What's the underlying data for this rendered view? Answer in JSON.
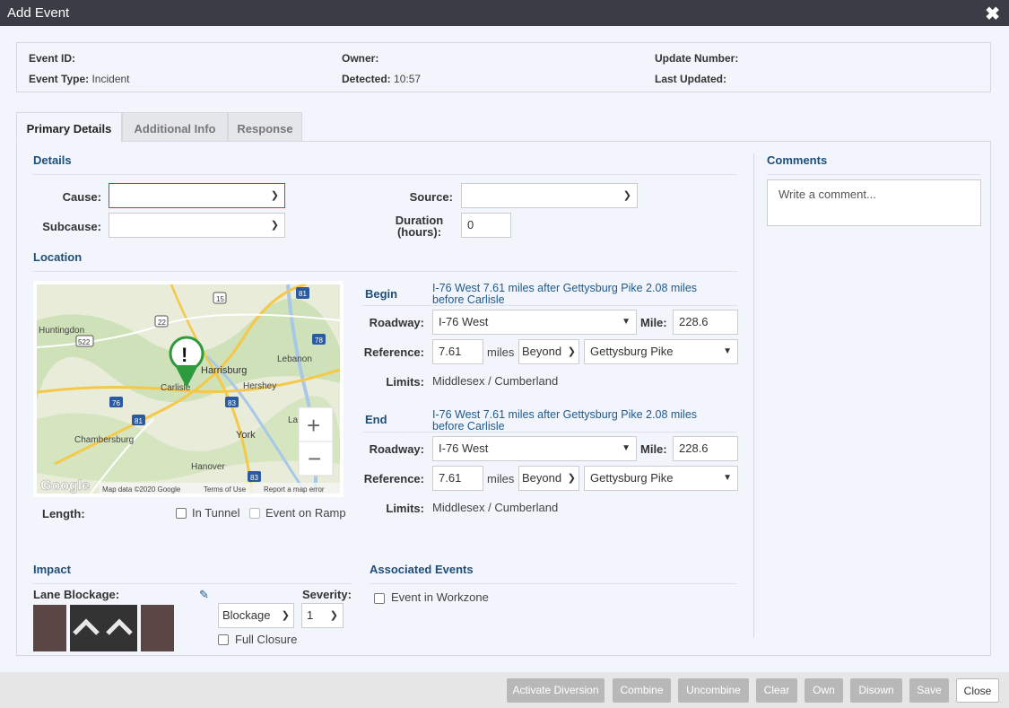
{
  "window": {
    "title": "Add Event",
    "close_icon": "close-icon"
  },
  "info": {
    "event_id_label": "Event ID:",
    "event_id_value": "",
    "event_type_label": "Event Type:",
    "event_type_value": "Incident",
    "owner_label": "Owner:",
    "owner_value": "",
    "detected_label": "Detected:",
    "detected_value": "10:57",
    "update_number_label": "Update Number:",
    "update_number_value": "",
    "last_updated_label": "Last Updated:",
    "last_updated_value": ""
  },
  "tabs": [
    {
      "label": "Primary Details",
      "active": true
    },
    {
      "label": "Additional Info",
      "active": false
    },
    {
      "label": "Response",
      "active": false
    }
  ],
  "details": {
    "heading": "Details",
    "cause_label": "Cause:",
    "cause_value": "",
    "subcause_label": "Subcause:",
    "subcause_value": "",
    "source_label": "Source:",
    "source_value": "",
    "duration_label_line1": "Duration",
    "duration_label_line2": "(hours):",
    "duration_value": "0"
  },
  "comments": {
    "heading": "Comments",
    "placeholder": "Write a comment..."
  },
  "location": {
    "heading": "Location",
    "map": {
      "places": [
        "Huntingdon",
        "Harrisburg",
        "Lebanon",
        "Carlisle",
        "Hershey",
        "Chambersburg",
        "York",
        "Hanover",
        "Lancaster"
      ],
      "shields": [
        "15",
        "81",
        "22",
        "522",
        "78",
        "76",
        "83",
        "81",
        "83"
      ],
      "attribution": "Map data ©2020 Google",
      "terms": "Terms of Use",
      "report": "Report a map error",
      "logo": "Google",
      "zoom_in": "+",
      "zoom_out": "−"
    },
    "length_label": "Length:",
    "in_tunnel_label": "In Tunnel",
    "event_on_ramp_label": "Event on Ramp",
    "begin": {
      "heading": "Begin",
      "description_line1": "I-76 West 7.61 miles after Gettysburg Pike 2.08 miles",
      "description_line2": "before Carlisle",
      "roadway_label": "Roadway:",
      "roadway_value": "I-76 West",
      "mile_label": "Mile:",
      "mile_value": "228.6",
      "reference_label": "Reference:",
      "reference_value": "7.61",
      "miles_text": "miles",
      "direction_value": "Beyond",
      "reference_point_value": "Gettysburg Pike",
      "limits_label": "Limits:",
      "limits_value": "Middlesex / Cumberland"
    },
    "end": {
      "heading": "End",
      "description_line1": "I-76 West 7.61 miles after Gettysburg Pike 2.08 miles",
      "description_line2": "before Carlisle",
      "roadway_label": "Roadway:",
      "roadway_value": "I-76 West",
      "mile_label": "Mile:",
      "mile_value": "228.6",
      "reference_label": "Reference:",
      "reference_value": "7.61",
      "miles_text": "miles",
      "direction_value": "Beyond",
      "reference_point_value": "Gettysburg Pike",
      "limits_label": "Limits:",
      "limits_value": "Middlesex / Cumberland"
    }
  },
  "impact": {
    "heading": "Impact",
    "lane_blockage_label": "Lane Blockage:",
    "severity_label": "Severity:",
    "blockage_value": "Blockage",
    "severity_value": "1",
    "full_closure_label": "Full Closure"
  },
  "associated": {
    "heading": "Associated Events",
    "workzone_label": "Event in Workzone"
  },
  "buttons": {
    "activate_diversion": "Activate Diversion",
    "combine": "Combine",
    "uncombine": "Uncombine",
    "clear": "Clear",
    "own": "Own",
    "disown": "Disown",
    "save": "Save",
    "close": "Close"
  },
  "colors": {
    "accent": "#1f4e79",
    "titlebar": "#3a3d45",
    "marker": "#2e9a3e",
    "lane_shoulder": "#5a4644",
    "lane_travel": "#333333"
  }
}
